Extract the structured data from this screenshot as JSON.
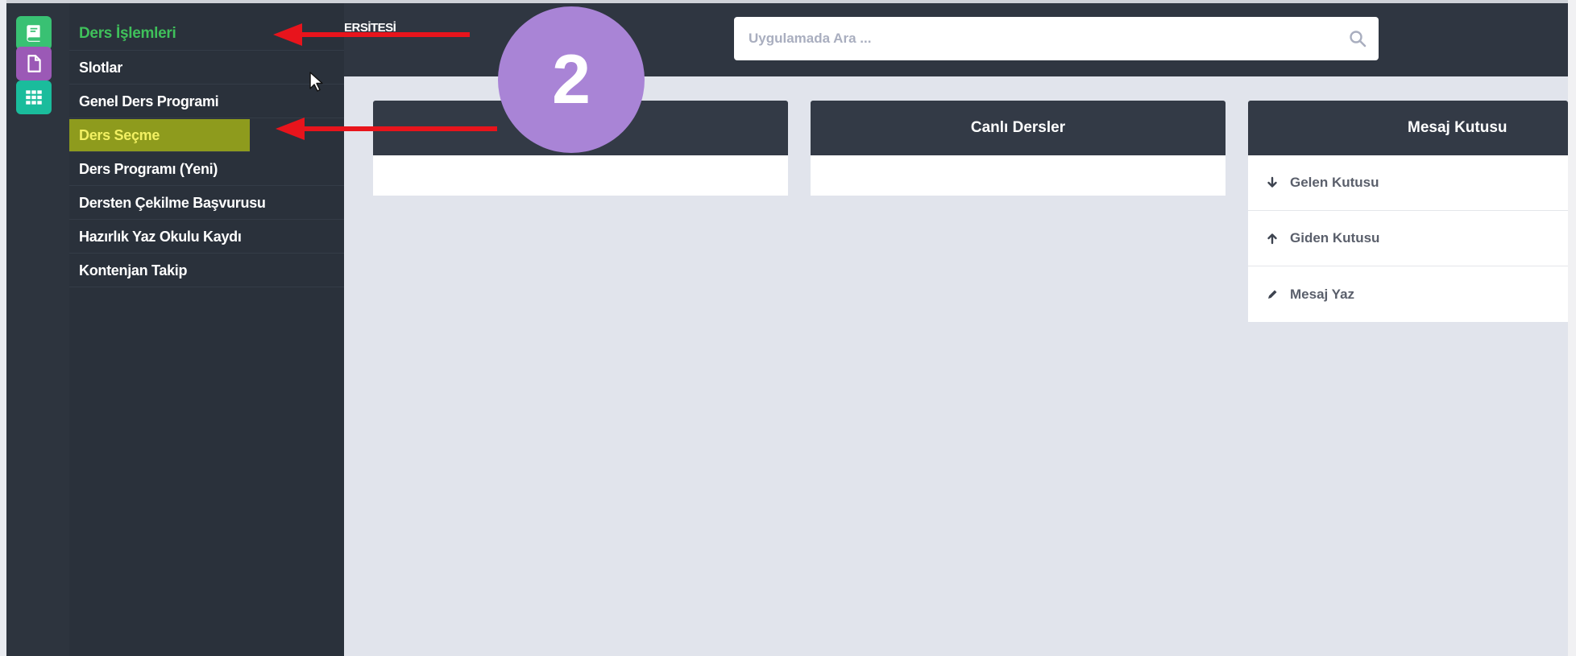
{
  "header": {
    "org_fragment": "ERSİTESİ",
    "search_placeholder": "Uygulamada Ara ..."
  },
  "rail": {
    "icons": [
      "book-icon",
      "document-icon",
      "grid-icon"
    ],
    "colors": [
      "#39c173",
      "#9b59b6",
      "#1abc9c"
    ]
  },
  "menu": {
    "items": [
      {
        "label": "Ders İşlemleri"
      },
      {
        "label": "Slotlar"
      },
      {
        "label": "Genel Ders Programi"
      },
      {
        "label": "Ders Seçme"
      },
      {
        "label": "Ders Programı (Yeni)"
      },
      {
        "label": "Dersten Çekilme Başvurusu"
      },
      {
        "label": "Hazırlık Yaz Okulu Kaydı"
      },
      {
        "label": "Kontenjan Takip"
      }
    ]
  },
  "cards": [
    {
      "title": ""
    },
    {
      "title": "Canlı Dersler"
    },
    {
      "title": "Mesaj Kutusu"
    }
  ],
  "messages": {
    "items": [
      {
        "label": "Gelen Kutusu",
        "icon": "arrow-down-icon"
      },
      {
        "label": "Giden Kutusu",
        "icon": "arrow-up-icon"
      },
      {
        "label": "Mesaj Yaz",
        "icon": "pencil-icon"
      }
    ]
  },
  "annotation": {
    "step_number": "2",
    "badge_color": "#a984d6",
    "arrow_color": "#e8141c"
  }
}
